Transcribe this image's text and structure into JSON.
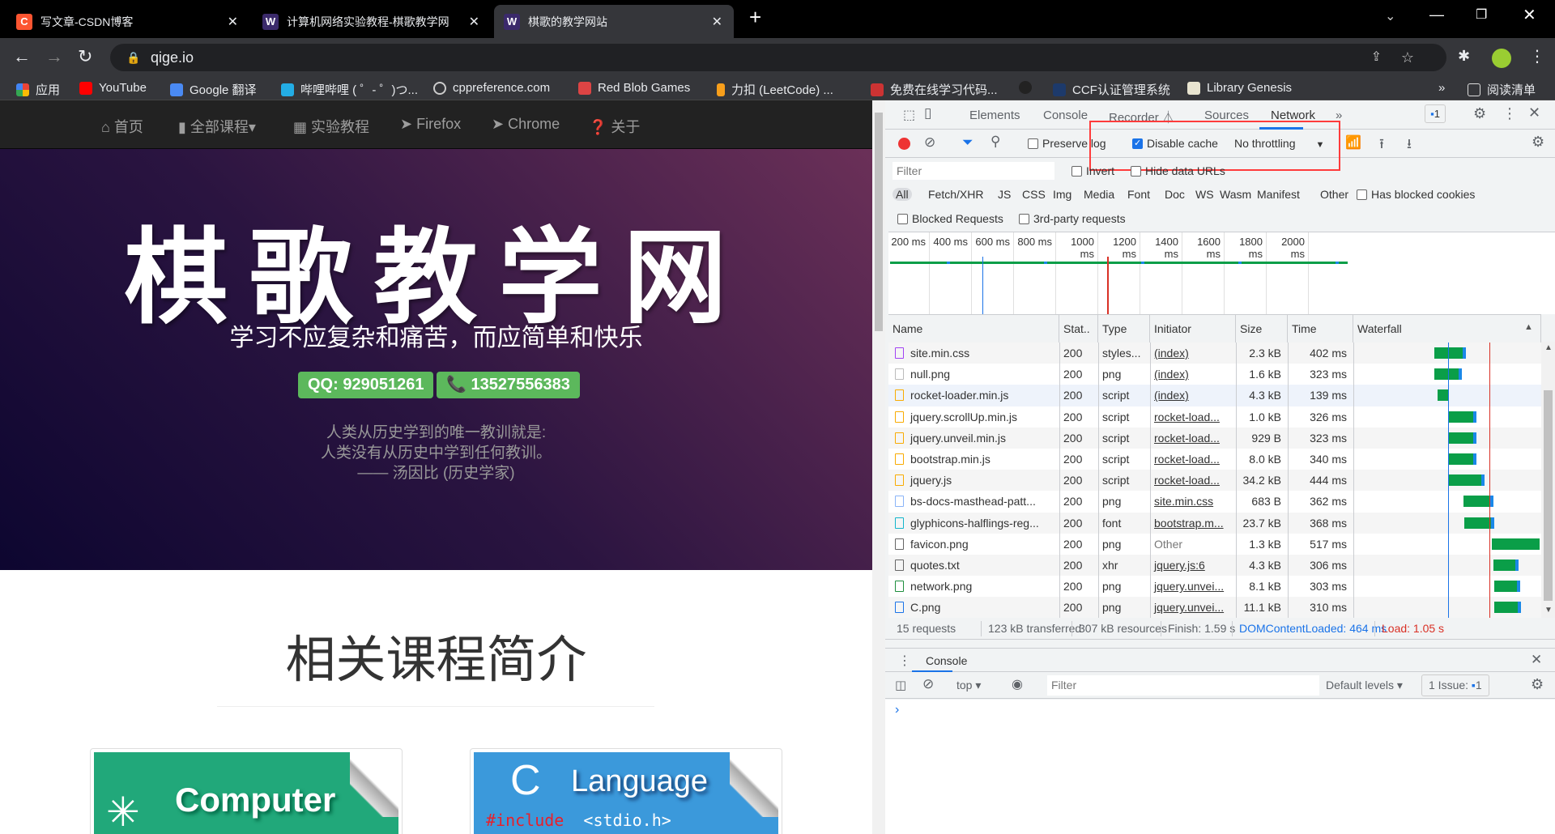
{
  "browser": {
    "tabs": [
      {
        "title": "写文章-CSDN博客",
        "favicon": "C",
        "color": "#fc5531"
      },
      {
        "title": "计算机网络实验教程-棋歌教学网",
        "favicon": "W",
        "color": "#3b2a6b"
      },
      {
        "title": "棋歌的教学网站",
        "favicon": "W",
        "color": "#3b2a6b",
        "active": true
      }
    ],
    "url": "qige.io",
    "bookmarks": [
      "应用",
      "YouTube",
      "Google 翻译",
      "哔哩哔哩 ( ゜- ゜)つ...",
      "cppreference.com",
      "Red Blob Games",
      "力扣 (LeetCode) ...",
      "免费在线学习代码...",
      "",
      "CCF认证管理系统",
      "Library Genesis"
    ],
    "reading_list": "阅读清单",
    "more": "»"
  },
  "site": {
    "nav": [
      "首页",
      "全部课程▾",
      "实验教程",
      "Firefox",
      "Chrome",
      "关于"
    ],
    "title": "棋歌教学网",
    "subtitle": "学习不应复杂和痛苦，而应简单和快乐",
    "qq": "QQ: 929051261",
    "phone": "13527556383",
    "quote": [
      "人类从历史学到的唯一教训就是:",
      "人类没有从历史中学到任何教训。",
      "—— 汤因比 (历史学家)"
    ],
    "section_title": "相关课程简介",
    "cards": [
      {
        "label": "Computer",
        "sub": ""
      },
      {
        "label": "Language",
        "big": "C",
        "code_kw": "#include",
        "code_rest": "<stdio.h>"
      }
    ]
  },
  "devtools": {
    "tabs": [
      "Elements",
      "Console",
      "Recorder ⏃",
      "Sources",
      "Network",
      "»"
    ],
    "active_tab": "Network",
    "issues_badge": "1",
    "toolbar": {
      "preserve_log": "Preserve log",
      "preserve_checked": false,
      "disable_cache": "Disable cache",
      "disable_checked": true,
      "throttling": "No throttling"
    },
    "filter_placeholder": "Filter",
    "invert": "Invert",
    "hide_data_urls": "Hide data URLs",
    "types": [
      "All",
      "Fetch/XHR",
      "JS",
      "CSS",
      "Img",
      "Media",
      "Font",
      "Doc",
      "WS",
      "Wasm",
      "Manifest",
      "Other"
    ],
    "has_blocked_cookies": "Has blocked cookies",
    "blocked_requests": "Blocked Requests",
    "third_party": "3rd-party requests",
    "overview_ticks": [
      "200 ms",
      "400 ms",
      "600 ms",
      "800 ms",
      "1000 ms",
      "1200 ms",
      "1400 ms",
      "1600 ms",
      "1800 ms",
      "2000 ms"
    ],
    "columns": [
      "Name",
      "Stat..",
      "Type",
      "Initiator",
      "Size",
      "Time",
      "Waterfall"
    ],
    "rows": [
      [
        "site.min.css",
        "200",
        "styles...",
        "(index)",
        "2.3 kB",
        "402 ms"
      ],
      [
        "null.png",
        "200",
        "png",
        "(index)",
        "1.6 kB",
        "323 ms"
      ],
      [
        "rocket-loader.min.js",
        "200",
        "script",
        "(index)",
        "4.3 kB",
        "139 ms"
      ],
      [
        "jquery.scrollUp.min.js",
        "200",
        "script",
        "rocket-load...",
        "1.0 kB",
        "326 ms"
      ],
      [
        "jquery.unveil.min.js",
        "200",
        "script",
        "rocket-load...",
        "929 B",
        "323 ms"
      ],
      [
        "bootstrap.min.js",
        "200",
        "script",
        "rocket-load...",
        "8.0 kB",
        "340 ms"
      ],
      [
        "jquery.js",
        "200",
        "script",
        "rocket-load...",
        "34.2 kB",
        "444 ms"
      ],
      [
        "bs-docs-masthead-patt...",
        "200",
        "png",
        "site.min.css",
        "683 B",
        "362 ms"
      ],
      [
        "glyphicons-halflings-reg...",
        "200",
        "font",
        "bootstrap.m...",
        "23.7 kB",
        "368 ms"
      ],
      [
        "favicon.png",
        "200",
        "png",
        "Other",
        "1.3 kB",
        "517 ms"
      ],
      [
        "quotes.txt",
        "200",
        "xhr",
        "jquery.js:6",
        "4.3 kB",
        "306 ms"
      ],
      [
        "network.png",
        "200",
        "png",
        "jquery.unvei...",
        "8.1 kB",
        "303 ms"
      ],
      [
        "C.png",
        "200",
        "png",
        "jquery.unvei...",
        "11.1 kB",
        "310 ms"
      ]
    ],
    "summary": {
      "requests": "15 requests",
      "transferred": "123 kB transferred",
      "resources": "307 kB resources",
      "finish": "Finish: 1.59 s",
      "dcl": "DOMContentLoaded: 464 ms",
      "load": "Load: 1.05 s"
    },
    "drawer": {
      "tab": "Console",
      "context": "top ▾",
      "filter_placeholder": "Filter",
      "levels": "Default levels ▾",
      "issues": "1 Issue:",
      "issues_count": "1",
      "prompt": "›"
    },
    "colors": {
      "dcl": "#1a73e8",
      "load": "#d93025",
      "bar": "#0a9e48",
      "highlight": "#ff3b3b"
    }
  }
}
